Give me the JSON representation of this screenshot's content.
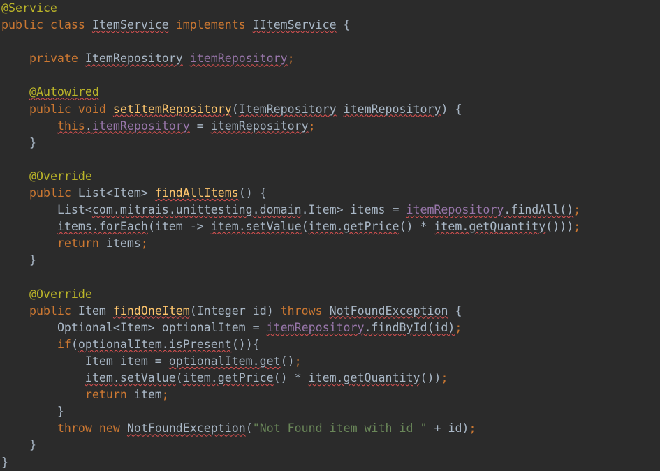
{
  "editor": {
    "language": "java",
    "theme": "darcula",
    "background_color": "#2b2b2b",
    "default_text_color": "#a9b7c6",
    "colors": {
      "keyword": "#cc7832",
      "annotation": "#bbb529",
      "identifier": "#a9b7c6",
      "method_declaration": "#ffc66d",
      "field": "#9876aa",
      "string": "#6a8759",
      "error_underline": "#e05252"
    }
  },
  "code": {
    "lines": [
      {
        "n": 1,
        "text": "@Service",
        "tokens": [
          {
            "t": "@Service",
            "c": "t-ann"
          }
        ]
      },
      {
        "n": 2,
        "text": "public class ItemService implements IItemService {",
        "tokens": [
          {
            "t": "public",
            "c": "t-kw"
          },
          {
            "t": " ",
            "c": "t-ident"
          },
          {
            "t": "class",
            "c": "t-kw"
          },
          {
            "t": " ",
            "c": "t-ident"
          },
          {
            "t": "ItemService",
            "c": "t-ident",
            "u": "sq"
          },
          {
            "t": " ",
            "c": "t-ident"
          },
          {
            "t": "implements",
            "c": "t-kw"
          },
          {
            "t": " ",
            "c": "t-ident"
          },
          {
            "t": "IItemService",
            "c": "t-ident",
            "u": "sq"
          },
          {
            "t": " {",
            "c": "t-ident"
          }
        ]
      },
      {
        "n": 3,
        "text": "",
        "tokens": []
      },
      {
        "n": 4,
        "text": "    private ItemRepository itemRepository;",
        "tokens": [
          {
            "t": "    ",
            "c": "t-ident"
          },
          {
            "t": "private",
            "c": "t-kw"
          },
          {
            "t": " ",
            "c": "t-ident"
          },
          {
            "t": "ItemRepository",
            "c": "t-ident",
            "u": "sq"
          },
          {
            "t": " ",
            "c": "t-ident"
          },
          {
            "t": "itemRepository",
            "c": "t-field",
            "u": "sq"
          },
          {
            "t": ";",
            "c": "t-semi"
          }
        ]
      },
      {
        "n": 5,
        "text": "",
        "tokens": []
      },
      {
        "n": 6,
        "text": "    @Autowired",
        "tokens": [
          {
            "t": "    ",
            "c": "t-ident"
          },
          {
            "t": "@Autowired",
            "c": "t-ann",
            "u": "sq"
          }
        ]
      },
      {
        "n": 7,
        "text": "    public void setItemRepository(ItemRepository itemRepository) {",
        "tokens": [
          {
            "t": "    ",
            "c": "t-ident"
          },
          {
            "t": "public",
            "c": "t-kw"
          },
          {
            "t": " ",
            "c": "t-ident"
          },
          {
            "t": "void",
            "c": "t-kw"
          },
          {
            "t": " ",
            "c": "t-ident"
          },
          {
            "t": "setItemRepository",
            "c": "t-mdecl",
            "u": "sq"
          },
          {
            "t": "(",
            "c": "t-ident"
          },
          {
            "t": "ItemRepository",
            "c": "t-ident",
            "u": "sq"
          },
          {
            "t": " ",
            "c": "t-ident"
          },
          {
            "t": "itemRepository",
            "c": "t-ident",
            "u": "sq"
          },
          {
            "t": ") {",
            "c": "t-ident"
          }
        ]
      },
      {
        "n": 8,
        "text": "        this.itemRepository = itemRepository;",
        "tokens": [
          {
            "t": "        ",
            "c": "t-ident"
          },
          {
            "t": "this",
            "c": "t-kw",
            "u": "sq"
          },
          {
            "t": ".",
            "c": "t-ident",
            "u": "sq"
          },
          {
            "t": "itemRepository",
            "c": "t-field",
            "u": "sq"
          },
          {
            "t": " = ",
            "c": "t-ident"
          },
          {
            "t": "itemRepository",
            "c": "t-ident",
            "u": "sq"
          },
          {
            "t": ";",
            "c": "t-semi"
          }
        ]
      },
      {
        "n": 9,
        "text": "    }",
        "tokens": [
          {
            "t": "    }",
            "c": "t-ident"
          }
        ]
      },
      {
        "n": 10,
        "text": "",
        "tokens": []
      },
      {
        "n": 11,
        "text": "    @Override",
        "tokens": [
          {
            "t": "    ",
            "c": "t-ident"
          },
          {
            "t": "@Override",
            "c": "t-ann"
          }
        ]
      },
      {
        "n": 12,
        "text": "    public List<Item> findAllItems() {",
        "tokens": [
          {
            "t": "    ",
            "c": "t-ident"
          },
          {
            "t": "public",
            "c": "t-kw"
          },
          {
            "t": " ",
            "c": "t-ident"
          },
          {
            "t": "List<Item>",
            "c": "t-ident"
          },
          {
            "t": " ",
            "c": "t-ident"
          },
          {
            "t": "findAllItems",
            "c": "t-mdecl",
            "u": "sq"
          },
          {
            "t": "() {",
            "c": "t-ident"
          }
        ]
      },
      {
        "n": 13,
        "text": "        List<com.mitrais.unittesting.domain.Item> items = itemRepository.findAll();",
        "tokens": [
          {
            "t": "        ",
            "c": "t-ident"
          },
          {
            "t": "List<",
            "c": "t-ident"
          },
          {
            "t": "com.mitrais.unittesting.domain",
            "c": "t-ident",
            "u": "sq"
          },
          {
            "t": ".Item> items = ",
            "c": "t-ident"
          },
          {
            "t": "itemRepository",
            "c": "t-field",
            "u": "sq"
          },
          {
            "t": ".findAll()",
            "c": "t-ident",
            "u": "sq"
          },
          {
            "t": ";",
            "c": "t-semi"
          }
        ]
      },
      {
        "n": 14,
        "text": "        items.forEach(item -> item.setValue(item.getPrice() * item.getQuantity()));",
        "tokens": [
          {
            "t": "        ",
            "c": "t-ident"
          },
          {
            "t": "items.forEach",
            "c": "t-ident",
            "u": "sq"
          },
          {
            "t": "(item -> ",
            "c": "t-ident"
          },
          {
            "t": "item.setValue",
            "c": "t-ident",
            "u": "sq"
          },
          {
            "t": "(",
            "c": "t-ident"
          },
          {
            "t": "item.getPrice",
            "c": "t-ident",
            "u": "sq"
          },
          {
            "t": "() * ",
            "c": "t-ident"
          },
          {
            "t": "item.getQuantity",
            "c": "t-ident",
            "u": "sq"
          },
          {
            "t": "()))",
            "c": "t-ident"
          },
          {
            "t": ";",
            "c": "t-semi"
          }
        ]
      },
      {
        "n": 15,
        "text": "        return items;",
        "tokens": [
          {
            "t": "        ",
            "c": "t-ident"
          },
          {
            "t": "return",
            "c": "t-kw"
          },
          {
            "t": " items",
            "c": "t-ident"
          },
          {
            "t": ";",
            "c": "t-semi"
          }
        ]
      },
      {
        "n": 16,
        "text": "    }",
        "tokens": [
          {
            "t": "    }",
            "c": "t-ident"
          }
        ]
      },
      {
        "n": 17,
        "text": "",
        "tokens": []
      },
      {
        "n": 18,
        "text": "    @Override",
        "tokens": [
          {
            "t": "    ",
            "c": "t-ident"
          },
          {
            "t": "@Override",
            "c": "t-ann"
          }
        ]
      },
      {
        "n": 19,
        "text": "    public Item findOneItem(Integer id) throws NotFoundException {",
        "tokens": [
          {
            "t": "    ",
            "c": "t-ident"
          },
          {
            "t": "public",
            "c": "t-kw"
          },
          {
            "t": " ",
            "c": "t-ident"
          },
          {
            "t": "Item",
            "c": "t-ident"
          },
          {
            "t": " ",
            "c": "t-ident"
          },
          {
            "t": "findOneItem",
            "c": "t-mdecl",
            "u": "sq"
          },
          {
            "t": "(Integer id) ",
            "c": "t-ident"
          },
          {
            "t": "throws",
            "c": "t-kw"
          },
          {
            "t": " ",
            "c": "t-ident"
          },
          {
            "t": "NotFoundException",
            "c": "t-ident",
            "u": "sq"
          },
          {
            "t": " {",
            "c": "t-ident"
          }
        ]
      },
      {
        "n": 20,
        "text": "        Optional<Item> optionalItem = itemRepository.findById(id);",
        "tokens": [
          {
            "t": "        ",
            "c": "t-ident"
          },
          {
            "t": "Optional<Item> optionalItem = ",
            "c": "t-ident"
          },
          {
            "t": "itemRepository",
            "c": "t-field",
            "u": "sq"
          },
          {
            "t": ".findById(id)",
            "c": "t-ident",
            "u": "sq"
          },
          {
            "t": ";",
            "c": "t-semi"
          }
        ]
      },
      {
        "n": 21,
        "text": "        if(optionalItem.isPresent()){",
        "tokens": [
          {
            "t": "        ",
            "c": "t-ident"
          },
          {
            "t": "if",
            "c": "t-kw"
          },
          {
            "t": "(",
            "c": "t-ident"
          },
          {
            "t": "optionalItem.isPresent",
            "c": "t-ident",
            "u": "sq"
          },
          {
            "t": "()){",
            "c": "t-ident"
          }
        ]
      },
      {
        "n": 22,
        "text": "            Item item = optionalItem.get();",
        "tokens": [
          {
            "t": "            ",
            "c": "t-ident"
          },
          {
            "t": "Item item = ",
            "c": "t-ident"
          },
          {
            "t": "optionalItem.get",
            "c": "t-ident",
            "u": "sq"
          },
          {
            "t": "()",
            "c": "t-ident"
          },
          {
            "t": ";",
            "c": "t-semi"
          }
        ]
      },
      {
        "n": 23,
        "text": "            item.setValue(item.getPrice() * item.getQuantity());",
        "tokens": [
          {
            "t": "            ",
            "c": "t-ident"
          },
          {
            "t": "item.setValue",
            "c": "t-ident",
            "u": "sq"
          },
          {
            "t": "(",
            "c": "t-ident"
          },
          {
            "t": "item.getPrice",
            "c": "t-ident",
            "u": "sq"
          },
          {
            "t": "() * ",
            "c": "t-ident"
          },
          {
            "t": "item.getQuantity",
            "c": "t-ident",
            "u": "sq"
          },
          {
            "t": "())",
            "c": "t-ident"
          },
          {
            "t": ";",
            "c": "t-semi"
          }
        ]
      },
      {
        "n": 24,
        "text": "            return item;",
        "tokens": [
          {
            "t": "            ",
            "c": "t-ident"
          },
          {
            "t": "return",
            "c": "t-kw"
          },
          {
            "t": " item",
            "c": "t-ident"
          },
          {
            "t": ";",
            "c": "t-semi"
          }
        ]
      },
      {
        "n": 25,
        "text": "        }",
        "tokens": [
          {
            "t": "        }",
            "c": "t-ident"
          }
        ]
      },
      {
        "n": 26,
        "text": "        throw new NotFoundException(\"Not Found item with id \" + id);",
        "tokens": [
          {
            "t": "        ",
            "c": "t-ident"
          },
          {
            "t": "throw",
            "c": "t-kw"
          },
          {
            "t": " ",
            "c": "t-ident"
          },
          {
            "t": "new",
            "c": "t-kw"
          },
          {
            "t": " ",
            "c": "t-ident"
          },
          {
            "t": "NotFoundException",
            "c": "t-ident",
            "u": "sq"
          },
          {
            "t": "(",
            "c": "t-ident"
          },
          {
            "t": "\"Not Found item with id \"",
            "c": "t-str"
          },
          {
            "t": " + id)",
            "c": "t-ident"
          },
          {
            "t": ";",
            "c": "t-semi"
          }
        ]
      },
      {
        "n": 27,
        "text": "    }",
        "tokens": [
          {
            "t": "    }",
            "c": "t-ident"
          }
        ]
      },
      {
        "n": 28,
        "text": "}",
        "tokens": [
          {
            "t": "}",
            "c": "t-ident"
          }
        ]
      }
    ]
  }
}
